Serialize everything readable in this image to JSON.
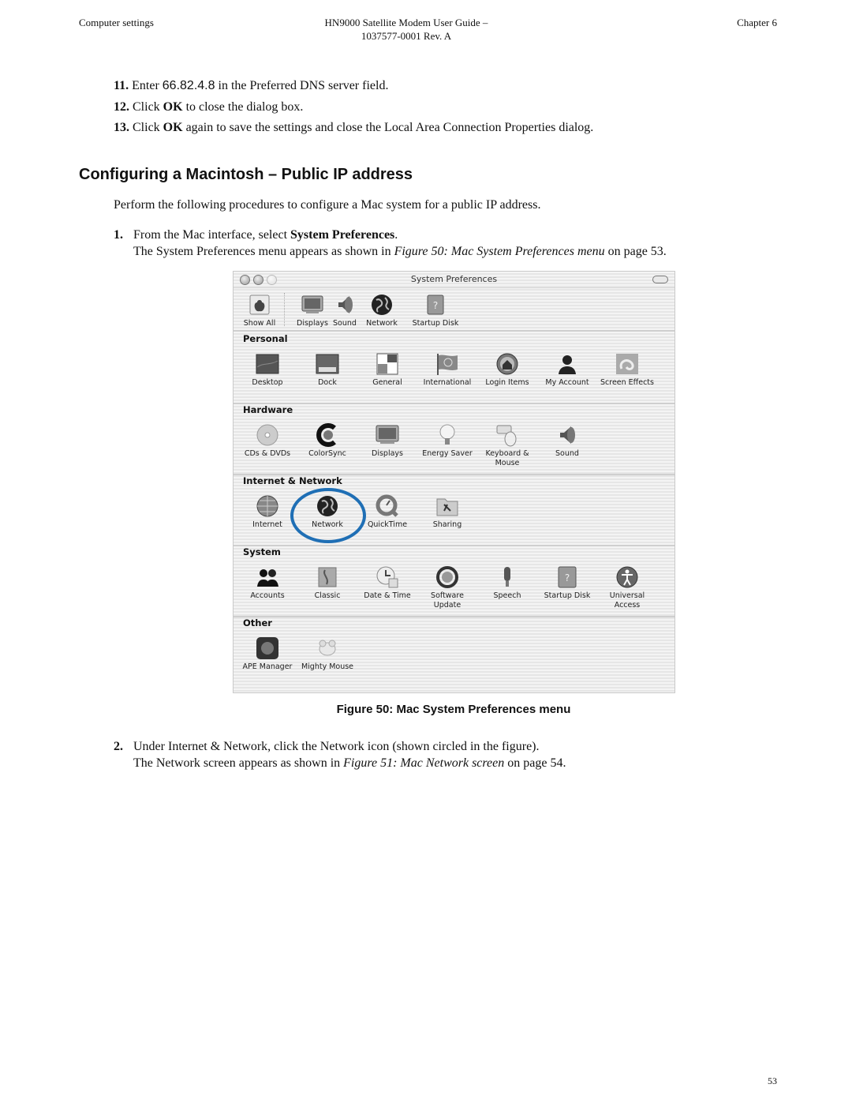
{
  "header": {
    "left": "Computer settings",
    "center_line1": "HN9000 Satellite Modem User Guide –",
    "center_line2": "1037577-0001 Rev. A",
    "right": "Chapter 6"
  },
  "steps_top": [
    {
      "num": "11.",
      "pre": "Enter ",
      "value": "66.82.4.8",
      "post": " in the Preferred DNS server field."
    },
    {
      "num": "12.",
      "pre": "Click ",
      "bold": "OK",
      "post": " to close the dialog box."
    },
    {
      "num": "13.",
      "pre": "Click ",
      "bold": "OK",
      "post": " again to save the settings and close the Local Area Connection Properties dialog."
    }
  ],
  "section_title": "Configuring a Macintosh – Public IP address",
  "intro": "Perform the following procedures to configure a Mac system for a public IP address.",
  "step1": {
    "num": "1.",
    "pre": "From the Mac interface, select ",
    "bold": "System Preferences",
    "post": ".",
    "line2_pre": "The System Preferences menu appears as shown in ",
    "line2_ref": "Figure 50: Mac System Preferences menu",
    "line2_post": " on page 53."
  },
  "window": {
    "title": "System Preferences",
    "toolbar": [
      "Show All",
      "Displays",
      "Sound",
      "Network",
      "Startup Disk"
    ],
    "sections": [
      {
        "title": "Personal",
        "items": [
          "Desktop",
          "Dock",
          "General",
          "International",
          "Login Items",
          "My Account",
          "Screen Effects"
        ]
      },
      {
        "title": "Hardware",
        "items": [
          "CDs & DVDs",
          "ColorSync",
          "Displays",
          "Energy Saver",
          "Keyboard & Mouse",
          "Sound"
        ]
      },
      {
        "title": "Internet & Network",
        "items": [
          "Internet",
          "Network",
          "QuickTime",
          "Sharing"
        ],
        "highlighted": "Network",
        "highlight_color": "#1f6fb5"
      },
      {
        "title": "System",
        "items": [
          "Accounts",
          "Classic",
          "Date & Time",
          "Software Update",
          "Speech",
          "Startup Disk",
          "Universal Access"
        ]
      },
      {
        "title": "Other",
        "items": [
          "APE Manager",
          "Mighty Mouse"
        ]
      }
    ]
  },
  "caption": "Figure 50: Mac System Preferences menu",
  "step2": {
    "num": "2.",
    "text": "Under Internet & Network, click the Network icon (shown circled in the figure).",
    "line2_pre": "The Network screen appears as shown in ",
    "line2_ref": "Figure 51: Mac Network screen",
    "line2_post": " on page 54."
  },
  "page_number": "53"
}
